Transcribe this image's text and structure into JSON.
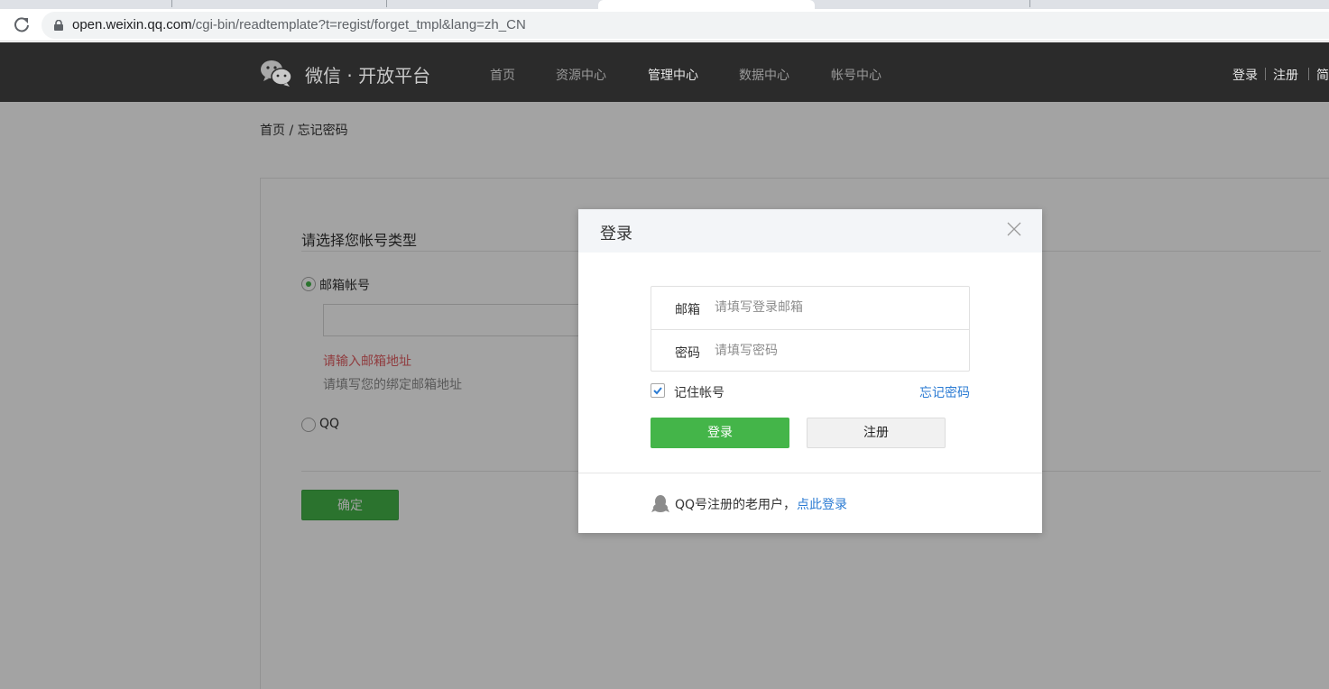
{
  "browser": {
    "url_host": "open.weixin.qq.com",
    "url_path": "/cgi-bin/readtemplate?t=regist/forget_tmpl&lang=zh_CN"
  },
  "nav": {
    "logo_text": "微信 · 开放平台",
    "items": [
      {
        "label": "首页"
      },
      {
        "label": "资源中心"
      },
      {
        "label": "管理中心",
        "active": true
      },
      {
        "label": "数据中心"
      },
      {
        "label": "帐号中心"
      }
    ],
    "login_label": "登录",
    "register_label": "注册",
    "lang_label": "简"
  },
  "breadcrumb": "首页 / 忘记密码",
  "forget_form": {
    "title": "请选择您帐号类型",
    "option_email": "邮箱帐号",
    "option_qq": "QQ",
    "error": "请输入邮箱地址",
    "hint": "请填写您的绑定邮箱地址",
    "confirm_label": "确定"
  },
  "login_modal": {
    "title": "登录",
    "email_label": "邮箱",
    "email_placeholder": "请填写登录邮箱",
    "password_label": "密码",
    "password_placeholder": "请填写密码",
    "remember_label": "记住帐号",
    "remember_checked": true,
    "forgot_label": "忘记密码",
    "login_button": "登录",
    "register_button": "注册",
    "qq_text": "QQ号注册的老用户，",
    "qq_link": "点此登录"
  },
  "colors": {
    "accent_green": "#44b549",
    "link_blue": "#2b7bd3",
    "error_red": "#e15f63",
    "nav_bg": "#2b2b2b"
  }
}
